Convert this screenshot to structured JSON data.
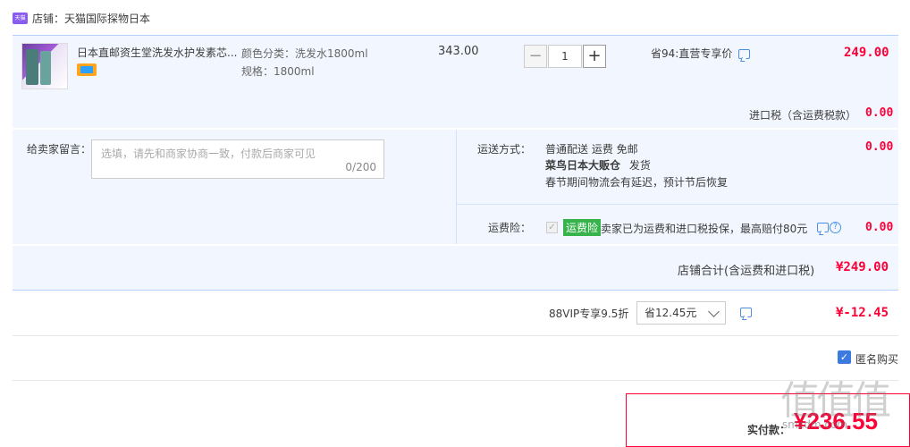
{
  "shop": {
    "label": "店铺：",
    "name": "天猫国际探物日本"
  },
  "item": {
    "title": "日本直邮资生堂洗发水护发素芯...",
    "sku_color": "颜色分类：洗发水1800ml",
    "sku_spec": "规格：1800ml",
    "unit_price": "343.00",
    "quantity": "1",
    "minus": "−",
    "plus": "+",
    "discount_label": "省94:直营专享价",
    "subtotal": "249.00"
  },
  "import_tax": {
    "label": "进口税（含运费税款）",
    "value": "0.00"
  },
  "message": {
    "label": "给卖家留言：",
    "placeholder": "选填，请先和商家协商一致，付款后商家可见",
    "count": "0/200"
  },
  "shipping": {
    "label": "运送方式：",
    "method": "普通配送 运费 免邮",
    "warehouse": "菜鸟日本大贩仓",
    "ship_text": "发货",
    "notice": "春节期间物流会有延迟，预计节后恢复",
    "fee": "0.00"
  },
  "insurance": {
    "label": "运费险：",
    "check": "✓",
    "badge": "运费险",
    "desc": "卖家已为运费和进口税投保，最高赔付80元",
    "question": "?",
    "fee": "0.00"
  },
  "shop_total": {
    "label": "店铺合计(含运费和进口税)",
    "value": "¥249.00"
  },
  "vip": {
    "label": "88VIP专享9.5折",
    "selected": "省12.45元",
    "value": "¥-12.45"
  },
  "anonymous": {
    "label": "匿名购买",
    "check": "✓"
  },
  "payment": {
    "label": "实付款：",
    "value": "¥236.55"
  },
  "watermark": {
    "brand": "值值值",
    "url": "smzdm.com"
  },
  "colors": {
    "accent_red": "#ff0036",
    "panel_blue": "#f2f7ff",
    "border_blue": "#b2d1ff"
  }
}
